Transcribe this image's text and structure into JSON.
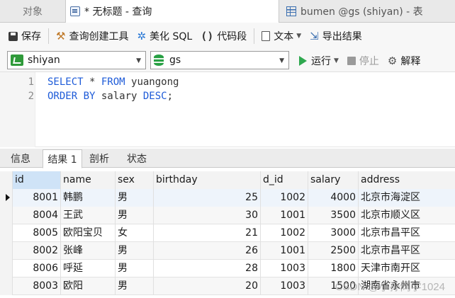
{
  "tabs": [
    {
      "label": "对象"
    },
    {
      "label": "* 无标题 - 查询"
    },
    {
      "label": "bumen @gs (shiyan) - 表"
    }
  ],
  "toolbar": {
    "save": "保存",
    "query_builder": "查询创建工具",
    "beautify_sql": "美化 SQL",
    "code_snippet": "代码段",
    "text": "文本",
    "export_results": "导出结果"
  },
  "connection": {
    "value": "shiyan",
    "icon": "connection-icon"
  },
  "database": {
    "value": "gs",
    "icon": "database-icon"
  },
  "actions": {
    "run": "运行",
    "stop": "停止",
    "explain": "解释"
  },
  "editor": {
    "lines": [
      {
        "num": "1",
        "keyword1": "SELECT",
        "text1": " * ",
        "keyword2": "FROM",
        "text2": " yuangong"
      },
      {
        "num": "2",
        "keyword1": "ORDER BY",
        "text1": " salary ",
        "keyword2": "DESC",
        "text2": ";"
      }
    ]
  },
  "result_tabs": [
    "信息",
    "结果 1",
    "剖析",
    "状态"
  ],
  "table": {
    "columns": [
      "id",
      "name",
      "sex",
      "birthday",
      "d_id",
      "salary",
      "address"
    ],
    "rows": [
      [
        "8001",
        "韩鹏",
        "男",
        "25",
        "1002",
        "4000",
        "北京市海淀区"
      ],
      [
        "8004",
        "王武",
        "男",
        "30",
        "1001",
        "3500",
        "北京市顺义区"
      ],
      [
        "8005",
        "欧阳宝贝",
        "女",
        "21",
        "1002",
        "3000",
        "北京市昌平区"
      ],
      [
        "8002",
        "张峰",
        "男",
        "26",
        "1001",
        "2500",
        "北京市昌平区"
      ],
      [
        "8006",
        "呼延",
        "男",
        "28",
        "1003",
        "1800",
        "天津市南开区"
      ],
      [
        "8003",
        "欧阳",
        "男",
        "20",
        "1003",
        "1500",
        "湖南省永州市"
      ]
    ]
  },
  "watermark": "CSDN @小孙同学1024"
}
